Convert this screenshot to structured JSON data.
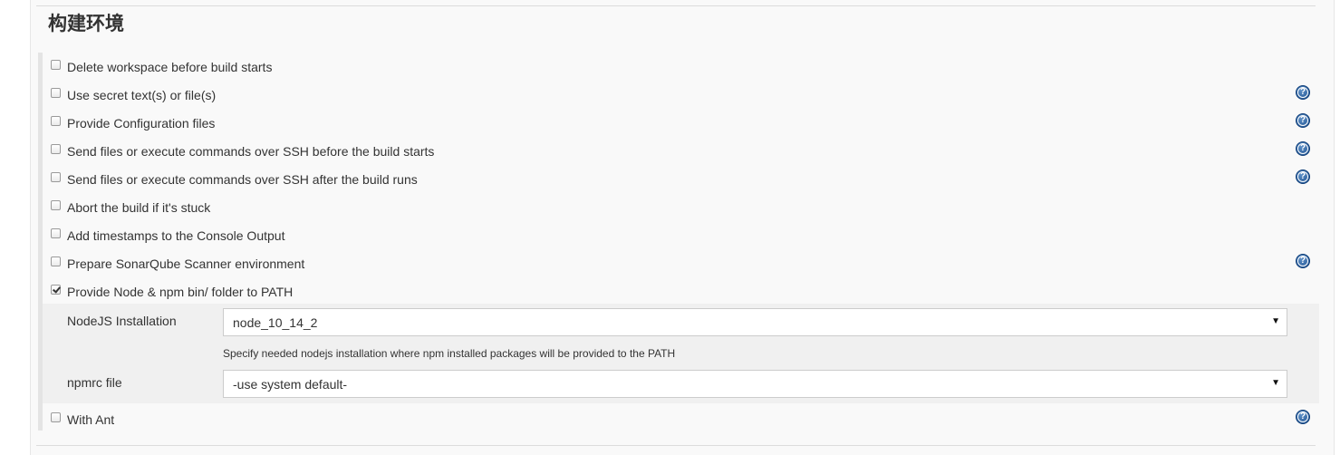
{
  "section": {
    "title": "构建环境"
  },
  "options": [
    {
      "label": "Delete workspace before build starts",
      "checked": false,
      "help": false
    },
    {
      "label": "Use secret text(s) or file(s)",
      "checked": false,
      "help": true
    },
    {
      "label": "Provide Configuration files",
      "checked": false,
      "help": true
    },
    {
      "label": "Send files or execute commands over SSH before the build starts",
      "checked": false,
      "help": true
    },
    {
      "label": "Send files or execute commands over SSH after the build runs",
      "checked": false,
      "help": true
    },
    {
      "label": "Abort the build if it's stuck",
      "checked": false,
      "help": false
    },
    {
      "label": "Add timestamps to the Console Output",
      "checked": false,
      "help": false
    },
    {
      "label": "Prepare SonarQube Scanner environment",
      "checked": false,
      "help": true
    },
    {
      "label": "Provide Node & npm bin/ folder to PATH",
      "checked": true,
      "help": false
    },
    {
      "label": "With Ant",
      "checked": false,
      "help": true
    }
  ],
  "node_config": {
    "nodejs_label": "NodeJS Installation",
    "nodejs_value": "node_10_14_2",
    "nodejs_hint": "Specify needed nodejs installation where npm installed packages will be provided to the PATH",
    "npmrc_label": "npmrc file",
    "npmrc_value": "-use system default-"
  },
  "icons": {
    "help": "help-icon",
    "select_arrow": "▼",
    "help_glyph": "?"
  },
  "colors": {
    "help_icon": "#1d4f8c",
    "panel_bg": "#f9f9f9",
    "sub_block_bg": "#f0f0f0"
  }
}
